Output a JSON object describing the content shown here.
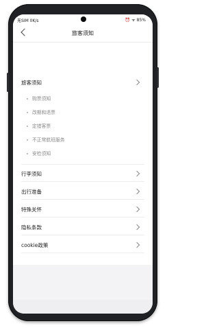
{
  "status": {
    "left": "无SIM 0K/s",
    "right": "⏰ ᯤ 85%"
  },
  "nav": {
    "title": "旅客须知"
  },
  "sections": {
    "travel_notice": {
      "label": "旅客须知",
      "subitems": [
        "购票须知",
        "改期和退票",
        "定错客票",
        "不正常航班服务",
        "安检须知"
      ]
    },
    "items": [
      {
        "label": "行李须知"
      },
      {
        "label": "出行准备"
      },
      {
        "label": "特殊关怀"
      },
      {
        "label": "隐私条款"
      },
      {
        "label": "cookie政策"
      }
    ]
  }
}
